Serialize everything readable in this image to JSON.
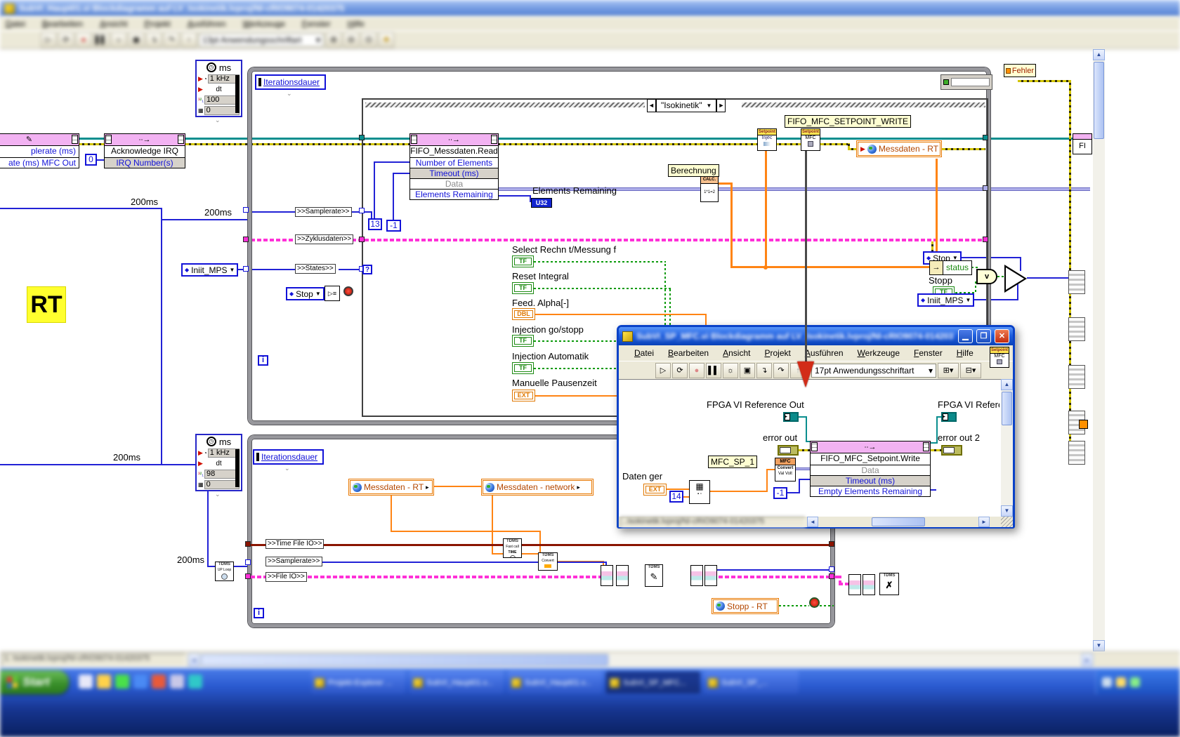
{
  "main_window": {
    "title": "SubVI_Haupt01.vi Blockdiagramm auf LV_Isokinetik.lvproj/NI-cRIO9074-01420375",
    "menu": [
      "Datei",
      "Bearbeiten",
      "Ansicht",
      "Projekt",
      "Ausführen",
      "Werkzeuge",
      "Fenster",
      "Hilfe"
    ],
    "toolbar": {
      "font_selector": "13pt Anwendungsschriftart"
    },
    "status_text": "1. Isokinetik.lvproj/NI-cRIO9074-01420375"
  },
  "diagram": {
    "rt_label": "RT",
    "fehler_label": "Fehler",
    "iterationsdauer": "Iterationsdauer",
    "berechnung": "Berechnung",
    "fifo_mfc_setpoint_write_label": "FIFO_MFC_SETPOINT_WRITE",
    "elements_remaining_label": "Elements Remaining",
    "case_selector": "\"Isokinetik\"",
    "ms200": "200ms",
    "iteration_i": "i",
    "timed_loop_top": {
      "unit": "ms",
      "rate": "1 kHz",
      "dt": "dt",
      "period": "100",
      "offset": "0"
    },
    "timed_loop_bottom": {
      "unit": "ms",
      "rate": "1 kHz",
      "dt": "dt",
      "period": "98",
      "offset": "0"
    },
    "property_node": {
      "row1": "plerate (ms)",
      "row2": "ate (ms) MFC Out"
    },
    "invoke_irq": {
      "title": "Acknowledge IRQ",
      "row": "IRQ Number(s)",
      "const": "0"
    },
    "fifo_read": {
      "title": "FIFO_Messdaten.Read",
      "row1": "Number of Elements",
      "row2": "Timeout (ms)",
      "row3": "Data",
      "row4": "Elements Remaining"
    },
    "const_13": "13",
    "const_m1": "-1",
    "u32": "U32",
    "tunnel_samplerate": ">>Samplerate>>",
    "tunnel_zyklusdaten": ">>Zyklusdaten>>",
    "tunnel_states": ">>States>>",
    "tunnel_time_file_io": ">>Time File IO>>",
    "tunnel_file_io": ">>File IO>>",
    "local_init_mps": "Iniit_MPS",
    "local_stop": "Stop",
    "status_field": "status",
    "stopp_label": "Stopp",
    "booleans": [
      {
        "label": "Select Rechn t/Messung f",
        "type": "TF"
      },
      {
        "label": "Reset Integral",
        "type": "TF"
      },
      {
        "label": "Feed. Alpha[-]",
        "type": "DBL"
      },
      {
        "label": "Injection go/stopp",
        "type": "TF"
      },
      {
        "label": "Injection Automatik",
        "type": "TF"
      },
      {
        "label": "Manuelle Pausenzeit",
        "type": "EXT"
      }
    ],
    "shared_messdaten_rt": "Messdaten - RT",
    "shared_messdaten_network": "Messdaten - network",
    "shared_stopp_rt": "Stopp - RT",
    "setpoint_injec": {
      "header": "Setpoint",
      "body": "Injec"
    },
    "setpoint_mfc": {
      "header": "Setpoint",
      "body": "MFC"
    },
    "calc_node": {
      "header": "CALC.",
      "formula": "1*1=2"
    },
    "tdms_up_loop": {
      "title": "TDMS",
      "sub": "UP Loop"
    },
    "tdms_time": {
      "title": "TDMS",
      "sub": "Fast call",
      "sub2": "TIME"
    },
    "tdms_convert": {
      "title": "TDMS",
      "sub": "Convert"
    },
    "tdms_write": {
      "title": "TDMS"
    },
    "tdms_close": {
      "title": "TDMS"
    },
    "fi_partial": "FI"
  },
  "subwindow": {
    "title": "SubVI_SP_MFC.vi Blockdiagramm auf LV_Isokinetik.lvproj/NI-cRIO9074-01420375",
    "menu": [
      "Datei",
      "Bearbeiten",
      "Ansicht",
      "Projekt",
      "Ausführen",
      "Werkzeuge",
      "Fenster",
      "Hilfe"
    ],
    "toolbar": {
      "font_selector": "17pt Anwendungsschriftart"
    },
    "vi_icon": {
      "header": "Setpoint",
      "body": "MFC"
    },
    "content": {
      "fpga_ref_out_label": "FPGA VI Reference Out",
      "error_out_label": "error out",
      "fpga_ref2_label": "FPGA VI Referen",
      "error_out2_label": "error out 2",
      "mfc_sp1_label": "MFC_SP_1",
      "daten_ger_label": "Daten ger",
      "const_14": "14",
      "const_m1": "-1",
      "ext": "EXT",
      "fifo_write": {
        "title": "FIFO_MFC_Setpoint.Write",
        "row1": "Data",
        "row2": "Timeout (ms)",
        "row3": "Empty Elements Remaining"
      },
      "mfc_convert": {
        "header": "MFC",
        "line1": "Convert",
        "line2": "Val  Volt"
      }
    },
    "status_text": "..Isokinetik.lvproj/NI-cRIO9074-01420375"
  },
  "taskbar": {
    "start_label": "Start",
    "buttons": [
      {
        "label": "Projekt-Explorer ..."
      },
      {
        "label": "SubVI_Haupt01.v..."
      },
      {
        "label": "SubVI_Haupt01.v..."
      },
      {
        "label": "SubVI_SP_MFC..."
      },
      {
        "label": "SubVI_SP_..."
      }
    ]
  }
}
